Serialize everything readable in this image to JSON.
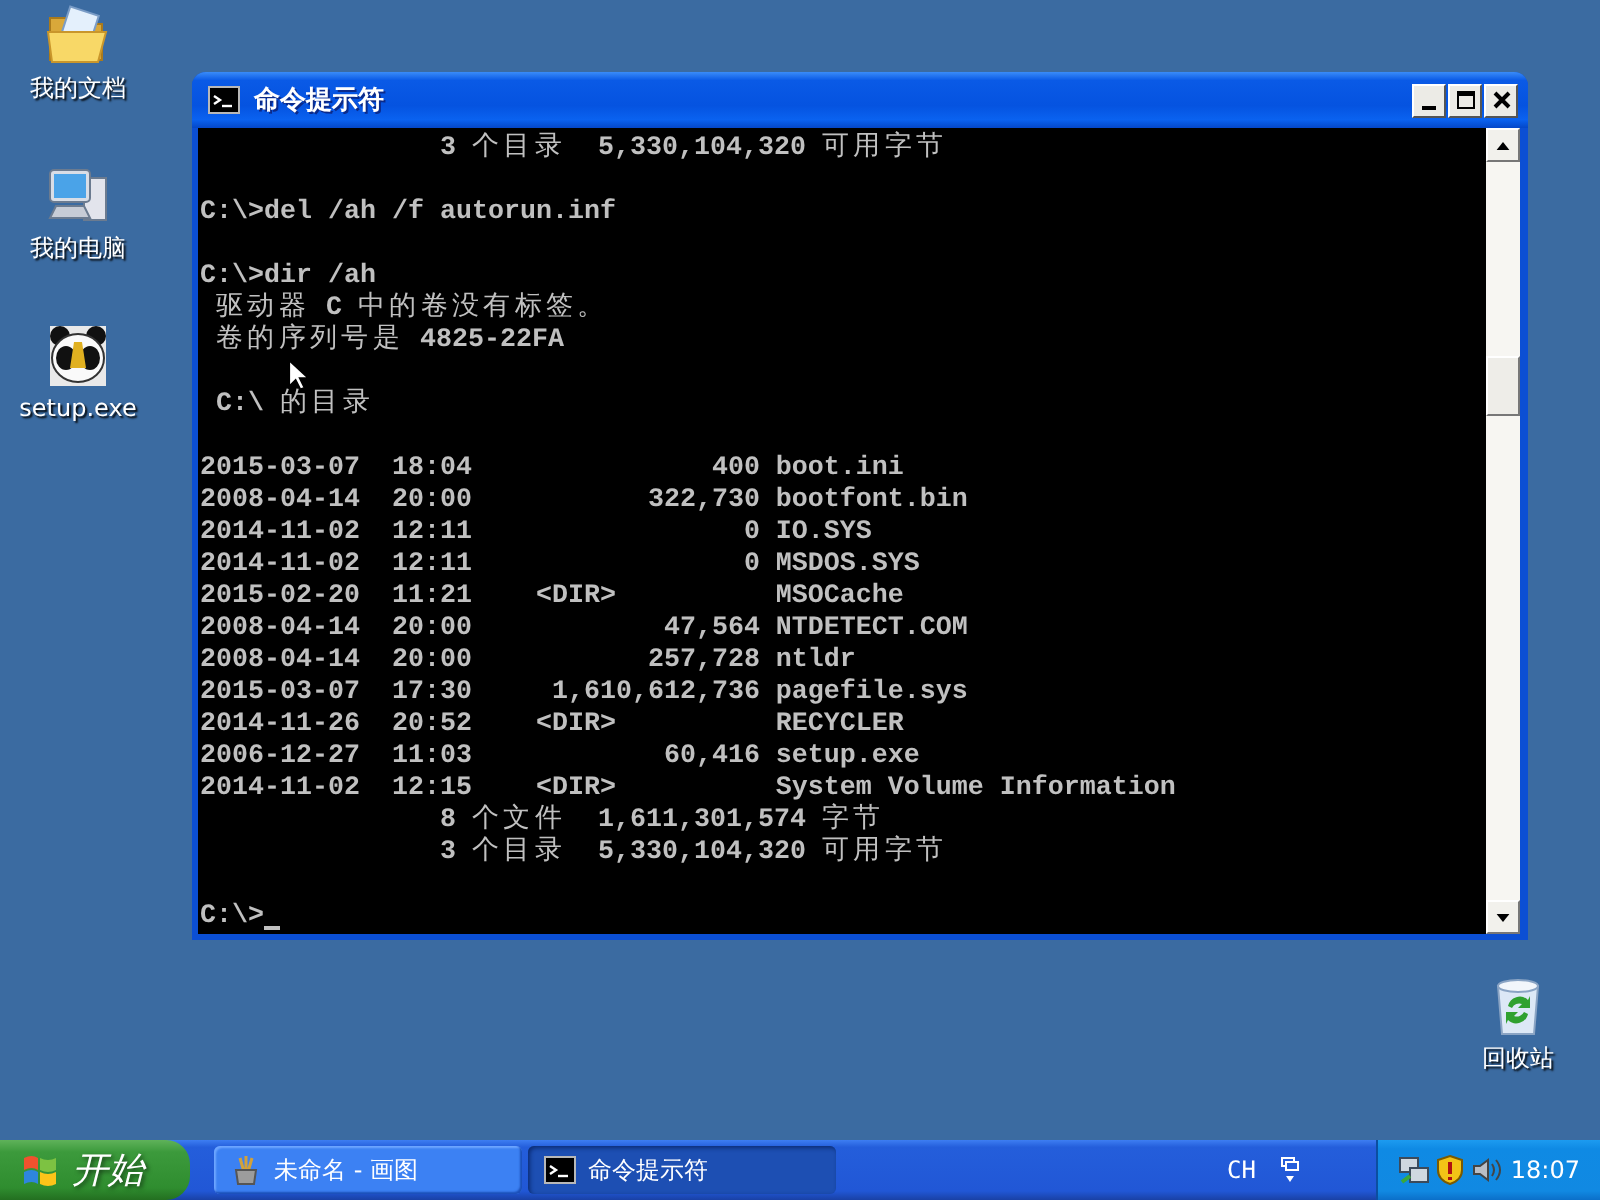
{
  "desktop_icons": [
    {
      "label": "我的文档",
      "kind": "documents"
    },
    {
      "label": "我的电脑",
      "kind": "computer"
    },
    {
      "label": "setup.exe",
      "kind": "program"
    }
  ],
  "recycle_bin": {
    "label": "回收站"
  },
  "window": {
    "title": "命令提示符",
    "console": {
      "blocks": [
        {
          "lines": [
            {
              "kind": "summary",
              "text": "3 个目录  5,330,104,320 可用字节"
            }
          ]
        },
        {
          "lines": [
            {
              "kind": "command",
              "text": "C:\\>del /ah /f autorun.inf"
            }
          ]
        },
        {
          "lines": [
            {
              "kind": "command",
              "text": "C:\\>dir /ah"
            },
            {
              "kind": "info",
              "text": "驱动器 C 中的卷没有标签。"
            },
            {
              "kind": "info",
              "text": "卷的序列号是 4825-22FA"
            }
          ]
        },
        {
          "lines": [
            {
              "kind": "info",
              "text": "C:\\ 的目录"
            }
          ]
        },
        {
          "lines": [
            {
              "kind": "entry",
              "text": "2015-03-07  18:04               400 boot.ini"
            },
            {
              "kind": "entry",
              "text": "2008-04-14  20:00           322,730 bootfont.bin"
            },
            {
              "kind": "entry",
              "text": "2014-11-02  12:11                 0 IO.SYS"
            },
            {
              "kind": "entry",
              "text": "2014-11-02  12:11                 0 MSDOS.SYS"
            },
            {
              "kind": "entry",
              "text": "2015-02-20  11:21    <DIR>          MSOCache"
            },
            {
              "kind": "entry",
              "text": "2008-04-14  20:00            47,564 NTDETECT.COM"
            },
            {
              "kind": "entry",
              "text": "2008-04-14  20:00           257,728 ntldr"
            },
            {
              "kind": "entry",
              "text": "2015-03-07  17:30     1,610,612,736 pagefile.sys"
            },
            {
              "kind": "entry",
              "text": "2014-11-26  20:52    <DIR>          RECYCLER"
            },
            {
              "kind": "entry",
              "text": "2006-12-27  11:03            60,416 setup.exe"
            },
            {
              "kind": "entry",
              "text": "2014-11-02  12:15    <DIR>          System Volume Information"
            },
            {
              "kind": "summary",
              "text": "8 个文件  1,611,301,574 字节"
            },
            {
              "kind": "summary",
              "text": "3 个目录  5,330,104,320 可用字节"
            }
          ]
        },
        {
          "lines": [
            {
              "kind": "prompt",
              "text": "C:\\>"
            }
          ]
        }
      ]
    }
  },
  "taskbar": {
    "start": {
      "label": "开始"
    },
    "tasks": [
      {
        "label": "未命名 - 画图",
        "kind": "paint",
        "selected": false
      },
      {
        "label": "命令提示符",
        "kind": "console",
        "selected": true
      }
    ],
    "language": "CH",
    "clock": "18:07"
  }
}
